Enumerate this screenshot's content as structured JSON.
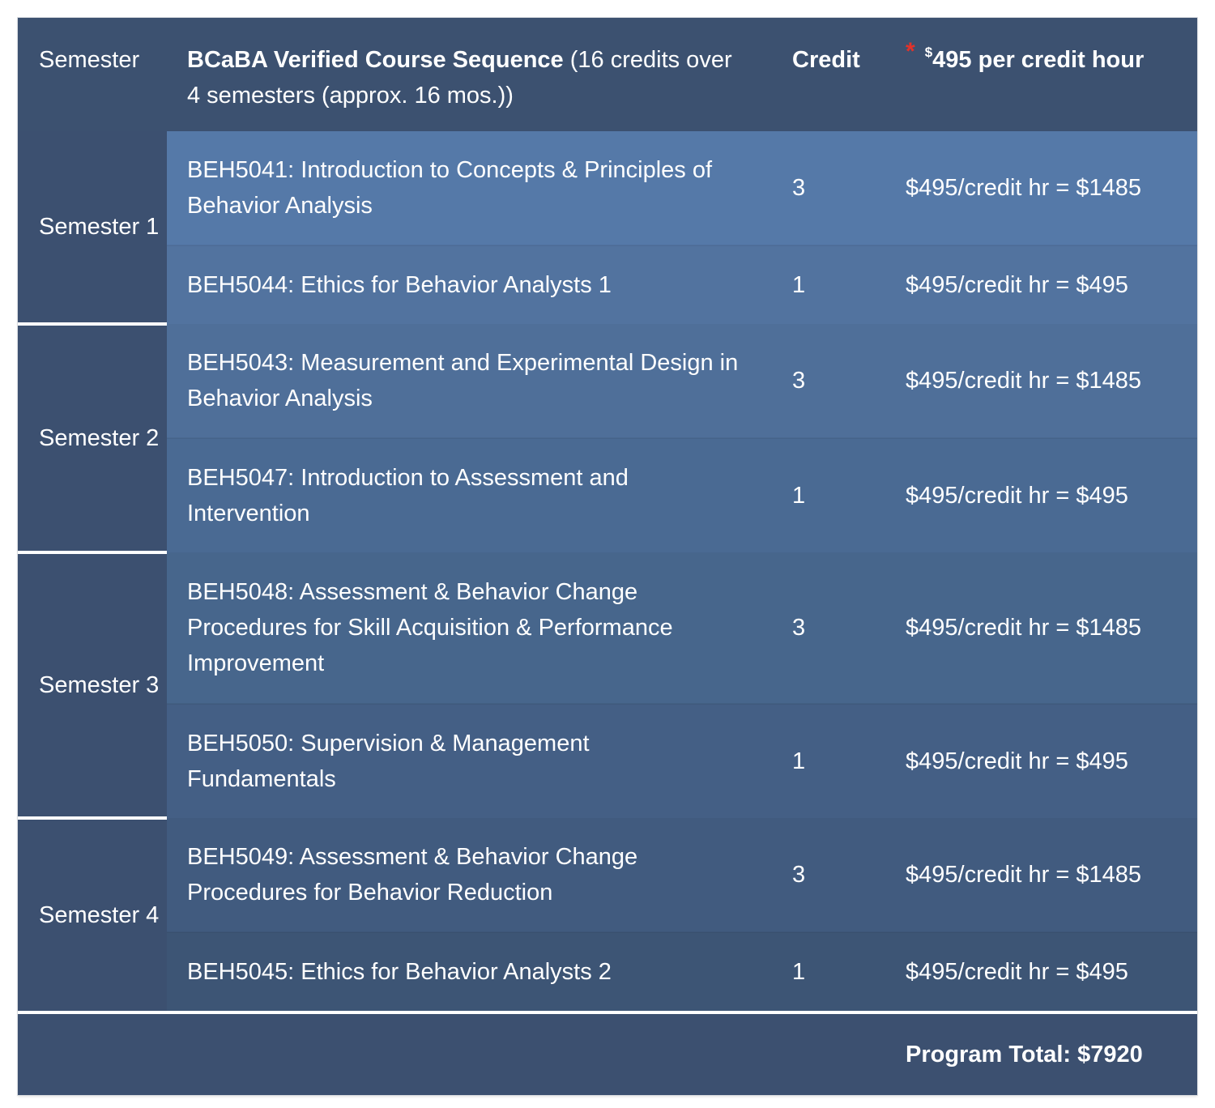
{
  "table": {
    "headers": {
      "semester": "Semester",
      "course_bold": "BCaBA Verified Course Sequence",
      "course_rest": " (16 credits over 4 semesters (approx. 16 mos.))",
      "credit": "Credit",
      "cost_asterisk": "*",
      "cost_currency": "$",
      "cost_rest": "495 per credit hour"
    },
    "semesters": [
      {
        "label": "Semester 1",
        "courses": [
          {
            "name": "BEH5041: Introduction to Concepts & Principles of Behavior Analysis",
            "credit": "3",
            "cost": "$495/credit hr = $1485",
            "row_color": "#5579a8"
          },
          {
            "name": "BEH5044: Ethics for Behavior Analysts 1",
            "credit": "1",
            "cost": "$495/credit hr = $495",
            "row_color": "#52739f"
          }
        ]
      },
      {
        "label": "Semester 2",
        "courses": [
          {
            "name": "BEH5043: Measurement and Experimental Design in Behavior Analysis",
            "credit": "3",
            "cost": "$495/credit hr = $1485",
            "row_color": "#4f6f99"
          },
          {
            "name": "BEH5047: Introduction to Assessment and Intervention",
            "credit": "1",
            "cost": "$495/credit hr = $495",
            "row_color": "#4a6a93"
          }
        ]
      },
      {
        "label": "Semester 3",
        "courses": [
          {
            "name": "BEH5048: Assessment & Behavior Change Procedures for Skill Acquisition & Performance Improvement",
            "credit": "3",
            "cost": "$495/credit hr = $1485",
            "row_color": "#47668c"
          },
          {
            "name": "BEH5050: Supervision & Management Fundamentals",
            "credit": "1",
            "cost": "$495/credit hr = $495",
            "row_color": "#445f85"
          }
        ]
      },
      {
        "label": "Semester 4",
        "courses": [
          {
            "name": "BEH5049: Assessment & Behavior Change Procedures for Behavior Reduction",
            "credit": "3",
            "cost": "$495/credit hr = $1485",
            "row_color": "#415b7f"
          },
          {
            "name": "BEH5045: Ethics for Behavior Analysts 2",
            "credit": "1",
            "cost": "$495/credit hr = $495",
            "row_color": "#3d5575"
          }
        ]
      }
    ],
    "total": "Program Total: $7920"
  },
  "colors": {
    "header_bg": "#3c5170",
    "semester_bg": "#3c5070",
    "asterisk": "#e2322a",
    "text": "#ffffff"
  }
}
